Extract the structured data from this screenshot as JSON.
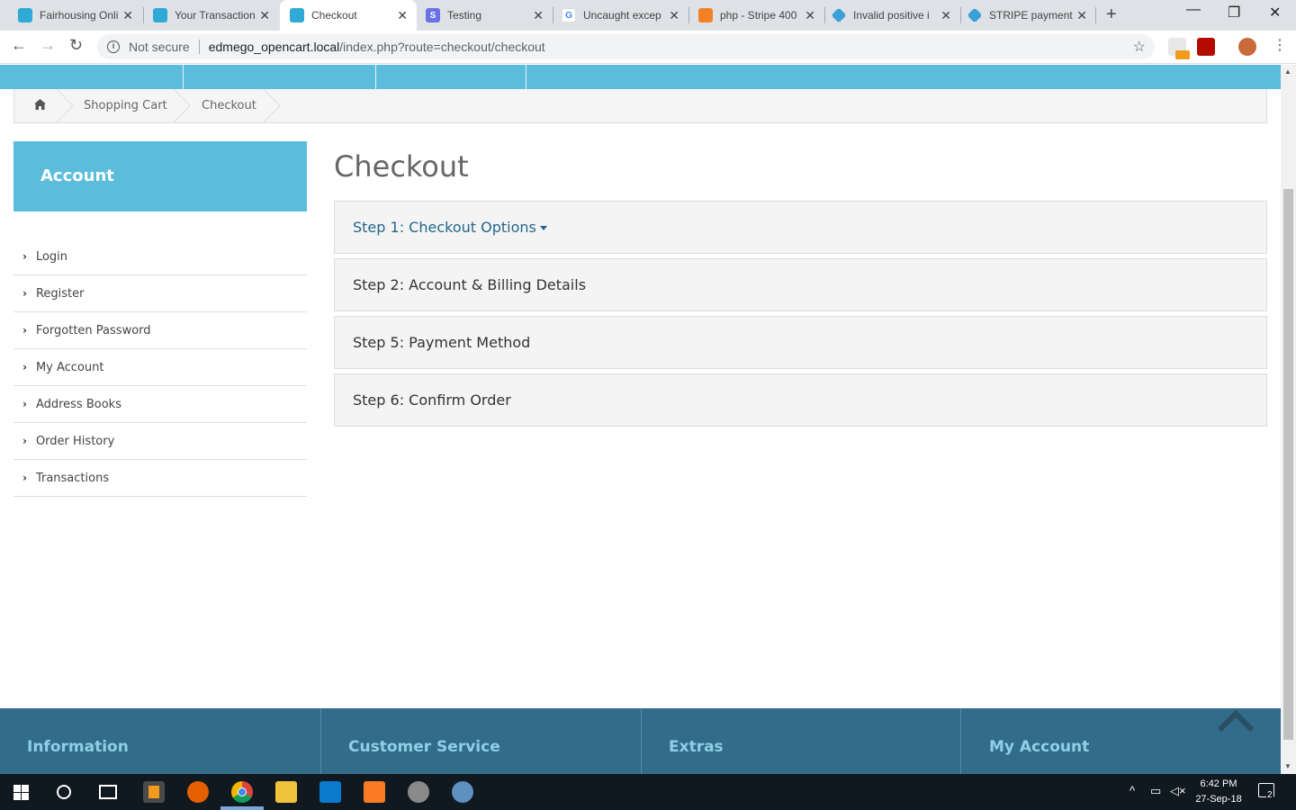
{
  "browser": {
    "tabs": [
      {
        "title": "Fairhousing Onli",
        "favicon_color": "#2fa9d6",
        "active": false
      },
      {
        "title": "Your Transaction",
        "favicon_color": "#2fa9d6",
        "active": false
      },
      {
        "title": "Checkout",
        "favicon_color": "#2fa9d6",
        "active": true
      },
      {
        "title": "Testing",
        "favicon_color": "#6772e5",
        "active": false
      },
      {
        "title": "Uncaught excep",
        "favicon_color": "#4285f4",
        "active": false
      },
      {
        "title": "php - Stripe 400",
        "favicon_color": "#f48024",
        "active": false
      },
      {
        "title": "Invalid positive i",
        "favicon_color": "#3aa0d8",
        "active": false
      },
      {
        "title": "STRIPE payment",
        "favicon_color": "#3aa0d8",
        "active": false
      }
    ],
    "security_label": "Not secure",
    "url_host": "edmego_opencart.local",
    "url_path": "/index.php?route=checkout/checkout"
  },
  "breadcrumb": {
    "home_icon": "home-icon",
    "items": [
      "Shopping Cart",
      "Checkout"
    ]
  },
  "sidebar": {
    "heading": "Account",
    "items": [
      "Login",
      "Register",
      "Forgotten Password",
      "My Account",
      "Address Books",
      "Order History",
      "Transactions"
    ]
  },
  "main": {
    "title": "Checkout",
    "steps": [
      {
        "label": "Step 1: Checkout Options",
        "active": true
      },
      {
        "label": "Step 2: Account & Billing Details",
        "active": false
      },
      {
        "label": "Step 5: Payment Method",
        "active": false
      },
      {
        "label": "Step 6: Confirm Order",
        "active": false
      }
    ]
  },
  "footer": {
    "columns": [
      "Information",
      "Customer Service",
      "Extras",
      "My Account"
    ]
  },
  "taskbar": {
    "time": "6:42 PM",
    "date": "27-Sep-18",
    "notifications": "2"
  },
  "colors": {
    "brand": "#5bbcdc",
    "footer": "#316d8a",
    "link": "#23678b"
  }
}
